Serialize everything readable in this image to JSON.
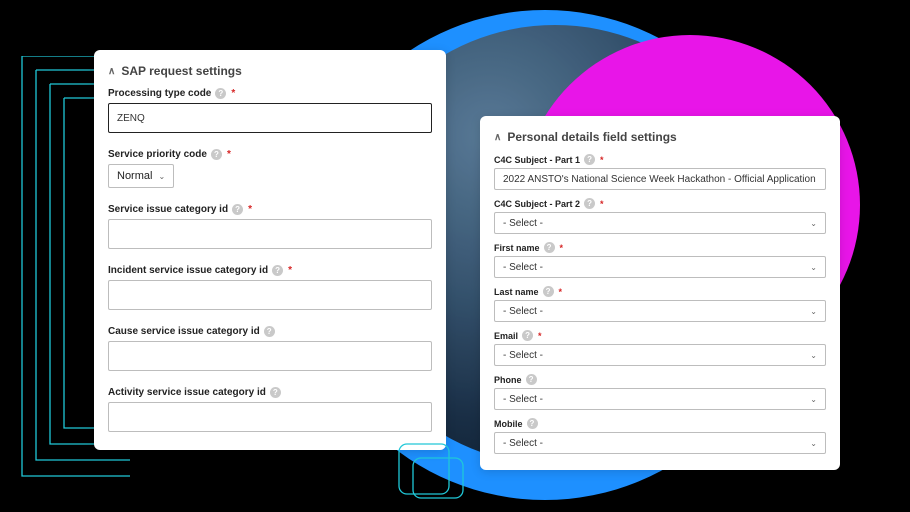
{
  "left": {
    "header": "SAP request settings",
    "fields": {
      "processing_type_code": {
        "label": "Processing type code",
        "value": "ZENQ",
        "required": true,
        "help": true
      },
      "service_priority_code": {
        "label": "Service priority code",
        "value": "Normal",
        "required": true,
        "help": true
      },
      "service_issue_cat": {
        "label": "Service issue category id",
        "required": true,
        "help": true
      },
      "incident_cat": {
        "label": "Incident service issue category id",
        "required": true,
        "help": true
      },
      "cause_cat": {
        "label": "Cause service issue category id",
        "required": false,
        "help": true
      },
      "activity_cat": {
        "label": "Activity service issue category id",
        "required": false,
        "help": true
      }
    }
  },
  "right": {
    "header": "Personal details field settings",
    "select_placeholder": "- Select -",
    "fields": {
      "c4c_part1": {
        "label": "C4C Subject - Part 1",
        "value": "2022 ANSTO's National Science Week Hackathon - Official Application",
        "required": true,
        "help": true
      },
      "c4c_part2": {
        "label": "C4C Subject - Part 2",
        "required": true,
        "help": true
      },
      "first_name": {
        "label": "First name",
        "required": true,
        "help": true
      },
      "last_name": {
        "label": "Last name",
        "required": true,
        "help": true
      },
      "email": {
        "label": "Email",
        "required": true,
        "help": true
      },
      "phone": {
        "label": "Phone",
        "required": false,
        "help": true
      },
      "mobile": {
        "label": "Mobile",
        "required": false,
        "help": true
      }
    }
  }
}
